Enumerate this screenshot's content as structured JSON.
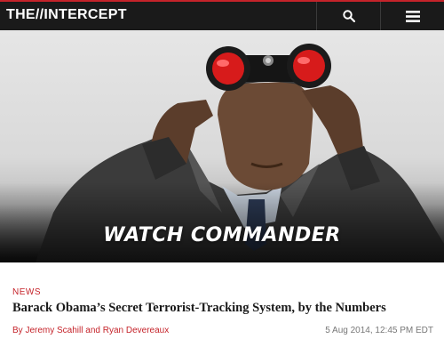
{
  "header": {
    "logo_text": "THE//INTERCEPT",
    "search_icon": "search-icon",
    "menu_icon": "hamburger-menu-icon",
    "accent_color": "#c5232a",
    "background_color": "#1a1a1a"
  },
  "hero": {
    "section_title": "WATCH COMMANDER",
    "image": "man-with-binoculars-photo"
  },
  "article": {
    "category": "NEWS",
    "headline": "Barack Obama’s Secret Terrorist-Tracking System, by the Numbers",
    "byline_prefix": "By",
    "author_1": "Jeremy Scahill",
    "byline_and": "and",
    "author_2": "Ryan Devereaux",
    "timestamp": "5 Aug 2014, 12:45 PM EDT"
  }
}
